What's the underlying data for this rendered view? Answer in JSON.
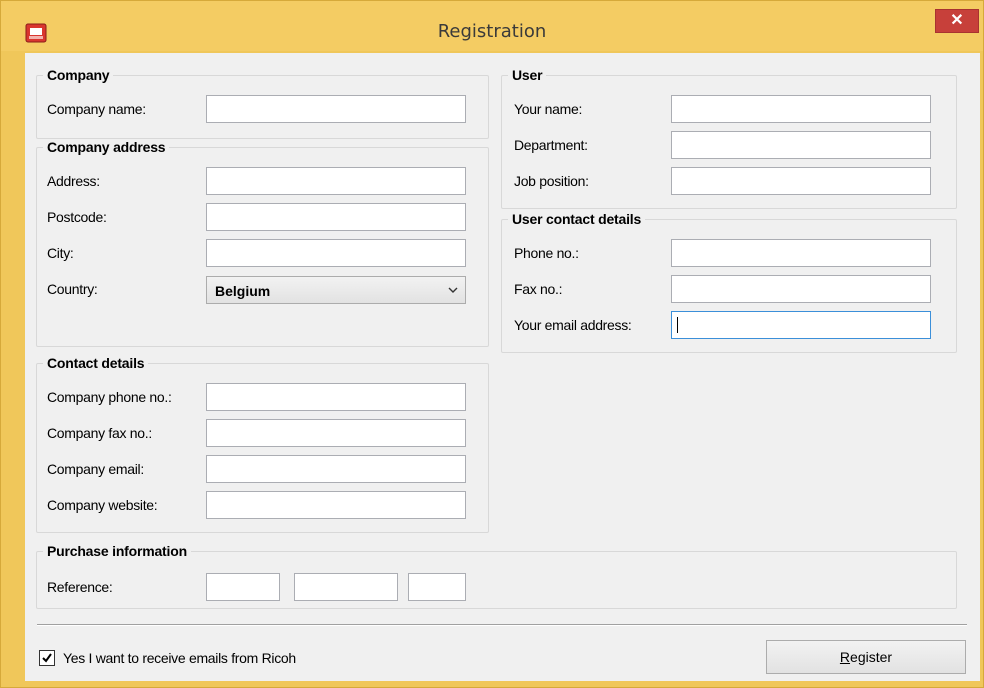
{
  "window": {
    "title": "Registration",
    "close_glyph": "✕",
    "icon": "ricoh-app-icon"
  },
  "company": {
    "title": "Company",
    "name_label": "Company name:",
    "name_value": ""
  },
  "company_address": {
    "title": "Company address",
    "address_label": "Address:",
    "postcode_label": "Postcode:",
    "city_label": "City:",
    "country_label": "Country:",
    "country_value": "Belgium"
  },
  "contact_details": {
    "title": "Contact details",
    "phone_label": "Company phone no.:",
    "fax_label": "Company fax no.:",
    "email_label": "Company email:",
    "website_label": "Company website:"
  },
  "purchase": {
    "title": "Purchase information",
    "reference_label": "Reference:"
  },
  "user": {
    "title": "User",
    "name_label": "Your name:",
    "department_label": "Department:",
    "job_label": "Job position:"
  },
  "user_contact": {
    "title": "User contact details",
    "phone_label": "Phone no.:",
    "fax_label": "Fax no.:",
    "email_label": "Your email address:"
  },
  "footer": {
    "checkbox_label": "Yes I want to receive emails from Ricoh",
    "checkbox_checked": true,
    "register_mnemonic": "R",
    "register_rest": "egister"
  },
  "colors": {
    "title_bar": "#f4cc63",
    "close_button": "#c7403a",
    "focus_border": "#3b8fd9"
  }
}
